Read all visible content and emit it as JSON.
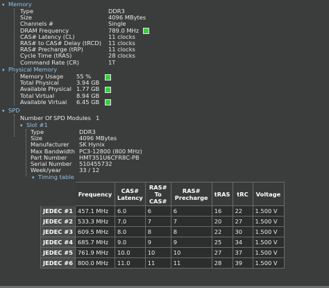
{
  "memory": {
    "header": "Memory",
    "rows": [
      {
        "label": "Type",
        "value": "DDR3"
      },
      {
        "label": "Size",
        "value": "4096 MBytes"
      },
      {
        "label": "Channels #",
        "value": "Single"
      },
      {
        "label": "DRAM Frequency",
        "value": "789.0 MHz"
      },
      {
        "label": "CAS# Latency (CL)",
        "value": "11 clocks"
      },
      {
        "label": "RAS# to CAS# Delay (tRCD)",
        "value": "11 clocks"
      },
      {
        "label": "RAS# Precharge (tRP)",
        "value": "11 clocks"
      },
      {
        "label": "Cycle Time (tRAS)",
        "value": "28 clocks"
      },
      {
        "label": "Command Rate (CR)",
        "value": "1T"
      }
    ]
  },
  "physical_memory": {
    "header": "Physical Memory",
    "rows": [
      {
        "label": "Memory Usage",
        "value": "55 %"
      },
      {
        "label": "Total Physical",
        "value": "3.94 GB"
      },
      {
        "label": "Available Physical",
        "value": "1.77 GB"
      },
      {
        "label": "Total Virtual",
        "value": "8.94 GB"
      },
      {
        "label": "Available Virtual",
        "value": "6.45 GB"
      }
    ]
  },
  "spd": {
    "header": "SPD",
    "modules_label": "Number Of SPD Modules",
    "modules_value": "1",
    "slot": {
      "header": "Slot #1",
      "rows": [
        {
          "label": "Type",
          "value": "DDR3"
        },
        {
          "label": "Size",
          "value": "4096 MBytes"
        },
        {
          "label": "Manufacturer",
          "value": "SK Hynix"
        },
        {
          "label": "Max Bandwidth",
          "value": "PC3-12800 (800 MHz)"
        },
        {
          "label": "Part Number",
          "value": "HMT351U6CFR8C-PB"
        },
        {
          "label": "Serial Number",
          "value": "510455732"
        },
        {
          "label": "Week/year",
          "value": "33 / 12"
        }
      ],
      "timing_header": "Timing table",
      "timing": {
        "columns": [
          "Frequency",
          "CAS# Latency",
          "RAS# To CAS#",
          "RAS# Precharge",
          "tRAS",
          "tRC",
          "Voltage"
        ],
        "rows": [
          {
            "name": "JEDEC #1",
            "cells": [
              "457.1 MHz",
              "6.0",
              "6",
              "6",
              "16",
              "22",
              "1.500 V"
            ]
          },
          {
            "name": "JEDEC #2",
            "cells": [
              "533.3 MHz",
              "7.0",
              "7",
              "7",
              "20",
              "27",
              "1.500 V"
            ]
          },
          {
            "name": "JEDEC #3",
            "cells": [
              "609.5 MHz",
              "8.0",
              "8",
              "8",
              "22",
              "30",
              "1.500 V"
            ]
          },
          {
            "name": "JEDEC #4",
            "cells": [
              "685.7 MHz",
              "9.0",
              "9",
              "9",
              "25",
              "34",
              "1.500 V"
            ]
          },
          {
            "name": "JEDEC #5",
            "cells": [
              "761.9 MHz",
              "10.0",
              "10",
              "10",
              "27",
              "37",
              "1.500 V"
            ]
          },
          {
            "name": "JEDEC #6",
            "cells": [
              "800.0 MHz",
              "11.0",
              "11",
              "11",
              "28",
              "39",
              "1.500 V"
            ]
          }
        ]
      }
    }
  },
  "colors": {
    "background": "#3b3d3c",
    "section": "#8fc3ea",
    "indicator": "#36d13a"
  },
  "icons": [
    "collapse-triangle-icon",
    "usage-indicator-icon"
  ]
}
